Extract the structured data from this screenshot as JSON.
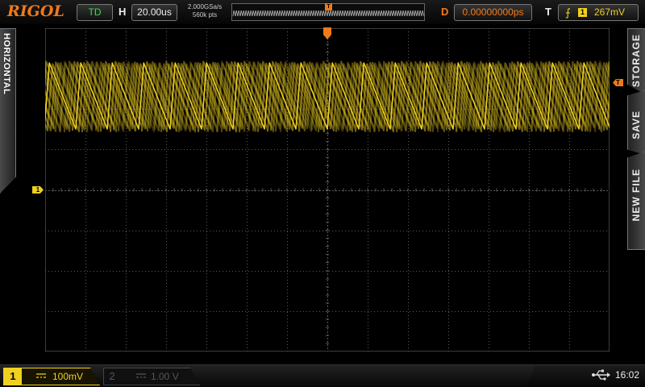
{
  "topbar": {
    "logo": "RIGOL",
    "run_mode": "TD",
    "h_label": "H",
    "timebase": "20.00us",
    "sample_rate": "2.000GSa/s",
    "memory_depth": "560k pts",
    "memory_trigger_marker": "T",
    "d_label": "D",
    "delay": "0.00000000ps",
    "t_label": "T",
    "trigger_channel": "1",
    "trigger_level": "267mV"
  },
  "left_menu": {
    "label": "HORIZONTAL"
  },
  "right_menu": {
    "items": [
      "STORAGE",
      "SAVE",
      "NEW FILE"
    ]
  },
  "markers": {
    "ch1": "1",
    "trigger_level": "T",
    "trigger_position": "T"
  },
  "bottombar": {
    "ch1_number": "1",
    "ch1_scale": "100mV",
    "ch2_number": "2",
    "ch2_scale": "1.00 V",
    "clock": "16:02"
  },
  "colors": {
    "ch1": "#f0d020",
    "trigger": "#f07a1a",
    "grid": "#5a5a5a",
    "run_status": "#35e04a"
  },
  "icons": [
    "trigger-rising-edge-icon",
    "usb-icon",
    "dc-coupling-icon"
  ]
}
